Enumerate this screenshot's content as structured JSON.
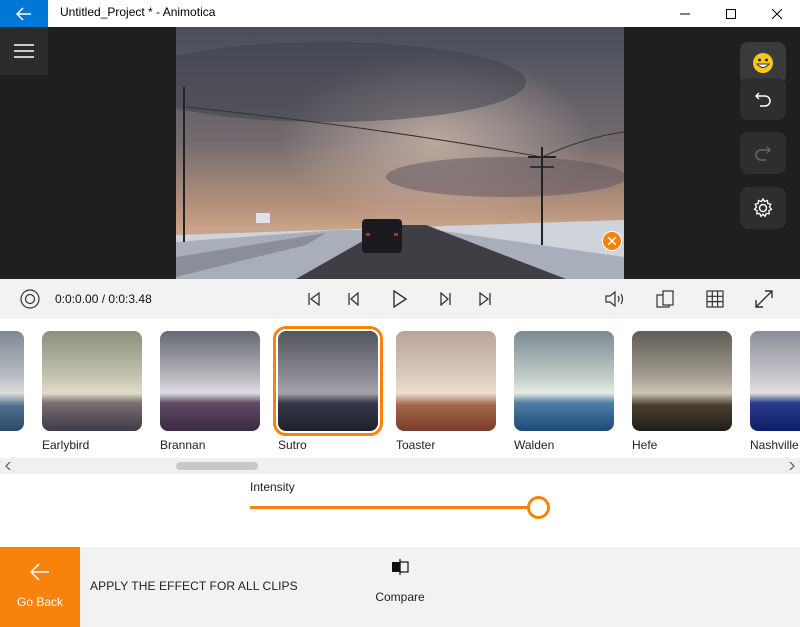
{
  "window": {
    "title": "Untitled_Project * - Animotica"
  },
  "icons": {
    "back": "arrow-left-icon",
    "menu": "hamburger-icon",
    "emoji": "emoji-icon",
    "undo": "undo-icon",
    "redo": "redo-icon",
    "settings": "gear-icon",
    "remove": "close-icon"
  },
  "player": {
    "time": "0:0:0.00 / 0:0:3.48"
  },
  "filters": [
    {
      "label": ""
    },
    {
      "label": "Earlybird"
    },
    {
      "label": "Brannan"
    },
    {
      "label": "Sutro"
    },
    {
      "label": "Toaster"
    },
    {
      "label": "Walden"
    },
    {
      "label": "Hefe"
    },
    {
      "label": "Nashville"
    }
  ],
  "selected_filter": "Sutro",
  "intensity": {
    "label": "Intensity",
    "value": 1.0
  },
  "bottom": {
    "go_back": "Go Back",
    "apply_all": "APPLY THE EFFECT FOR ALL CLIPS",
    "compare": "Compare"
  },
  "colors": {
    "accent": "#f7830d",
    "title_accent": "#0078d7"
  }
}
